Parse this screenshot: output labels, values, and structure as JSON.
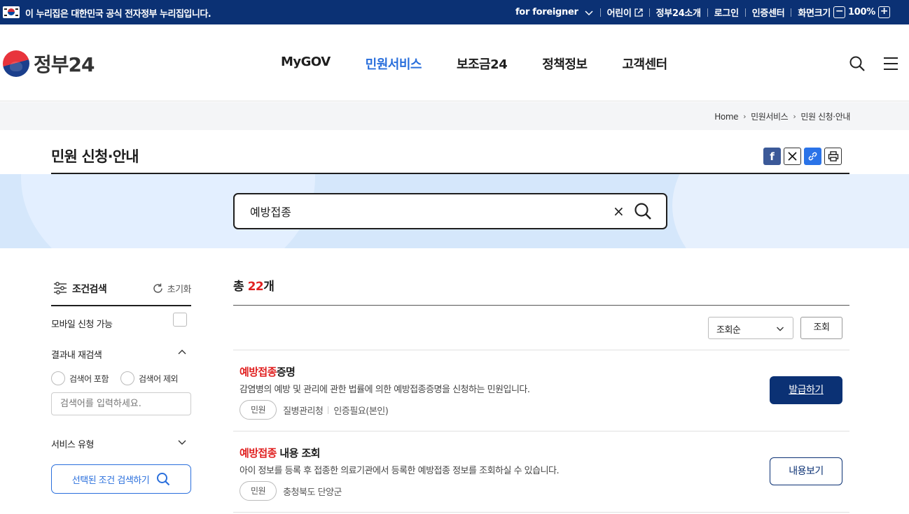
{
  "topbar": {
    "notice": "이 누리집은 대한민국 공식 전자정부 누리집입니다.",
    "for_foreigner": "for foreigner",
    "kids": "어린이",
    "about": "정부24소개",
    "login": "로그인",
    "cert": "인증센터",
    "zoom_label": "화면크기",
    "zoom_value": "100%",
    "zoom_minus": "−",
    "zoom_plus": "+"
  },
  "header": {
    "logo_text": "정부24",
    "menu": [
      "MyGOV",
      "민원서비스",
      "보조금24",
      "정책정보",
      "고객센터"
    ],
    "active_menu": "민원서비스"
  },
  "breadcrumb": [
    "Home",
    "민원서비스",
    "민원 신청·안내"
  ],
  "page": {
    "title": "민원 신청·안내"
  },
  "search": {
    "value": "예방접종",
    "clear": "×"
  },
  "sidebar": {
    "title": "조건검색",
    "reset": "초기화",
    "mobile_label": "모바일 신청 가능",
    "research_label": "결과내 재검색",
    "include_label": "검색어 포함",
    "exclude_label": "검색어 제외",
    "input_placeholder": "검색어를 입력하세요.",
    "service_type_label": "서비스 유형",
    "search_button": "선택된 조건 검색하기"
  },
  "results": {
    "total_prefix": "총 ",
    "total_count": "22",
    "total_suffix": "개",
    "sort_value": "조회순",
    "view_button": "조회",
    "items": [
      {
        "title_highlight": "예방접종",
        "title_rest": "증명",
        "desc": "감염병의 예방 및 관리에 관한 법률에 의한 예방접종증명을 신청하는 민원입니다.",
        "tag": "민원",
        "agency": "질병관리청",
        "auth": "인증필요(본인)",
        "button": "발급하기"
      },
      {
        "title_highlight": "예방접종",
        "title_rest": " 내용 조회",
        "desc": "아이 정보를 등록 후 접종한 의료기관에서 등록한 예방접종 정보를 조회하실 수 있습니다.",
        "tag": "민원",
        "agency": "충청북도 단양군",
        "button": "내용보기"
      }
    ]
  },
  "colors": {
    "navy": "#0b3174",
    "accent_blue": "#2a6fdc",
    "highlight_red": "#e02020",
    "search_band": "#d5e7fb"
  },
  "icons": {
    "flag": "korea-flag-icon",
    "external": "external-link-icon",
    "search": "search-icon",
    "menu": "hamburger-menu-icon",
    "filter": "filter-sliders-icon",
    "reset": "refresh-icon",
    "chevron": "chevron-icon",
    "share": [
      "facebook-icon",
      "x-icon",
      "link-icon",
      "print-icon"
    ]
  }
}
